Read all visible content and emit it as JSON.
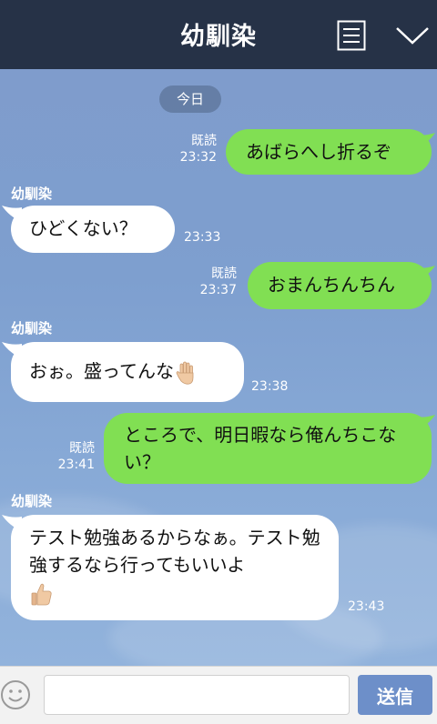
{
  "header": {
    "title": "幼馴染",
    "menu_icon": "list-menu-icon",
    "collapse_icon": "chevron-down-icon",
    "background": "#263247"
  },
  "chat": {
    "date_label": "今日",
    "messages": [
      {
        "direction": "out",
        "text": "あばらへし折るぞ",
        "read": "既読",
        "time": "23:32"
      },
      {
        "direction": "in",
        "sender": "幼馴染",
        "text": "ひどくない？",
        "time": "23:33"
      },
      {
        "direction": "out",
        "text": "おまんちんちん",
        "read": "既読",
        "time": "23:37"
      },
      {
        "direction": "in",
        "sender": "幼馴染",
        "text": "おぉ。盛ってんな",
        "emoji": "raised-hand-icon",
        "time": "23:38"
      },
      {
        "direction": "out",
        "text": "ところで、明日暇なら俺んちこない？",
        "read": "既読",
        "time": "23:41"
      },
      {
        "direction": "in",
        "sender": "幼馴染",
        "text": "テスト勉強あるからなぁ。テスト勉強するなら行ってもいいよ",
        "emoji": "thumbs-up-icon",
        "time": "23:43"
      }
    ]
  },
  "footer": {
    "emoji_icon": "smiley-icon",
    "input_value": "",
    "input_placeholder": "",
    "send_label": "送信"
  },
  "colors": {
    "outgoing_bubble": "#81df53",
    "incoming_bubble": "#ffffff",
    "send_button": "#6d8fc9"
  }
}
